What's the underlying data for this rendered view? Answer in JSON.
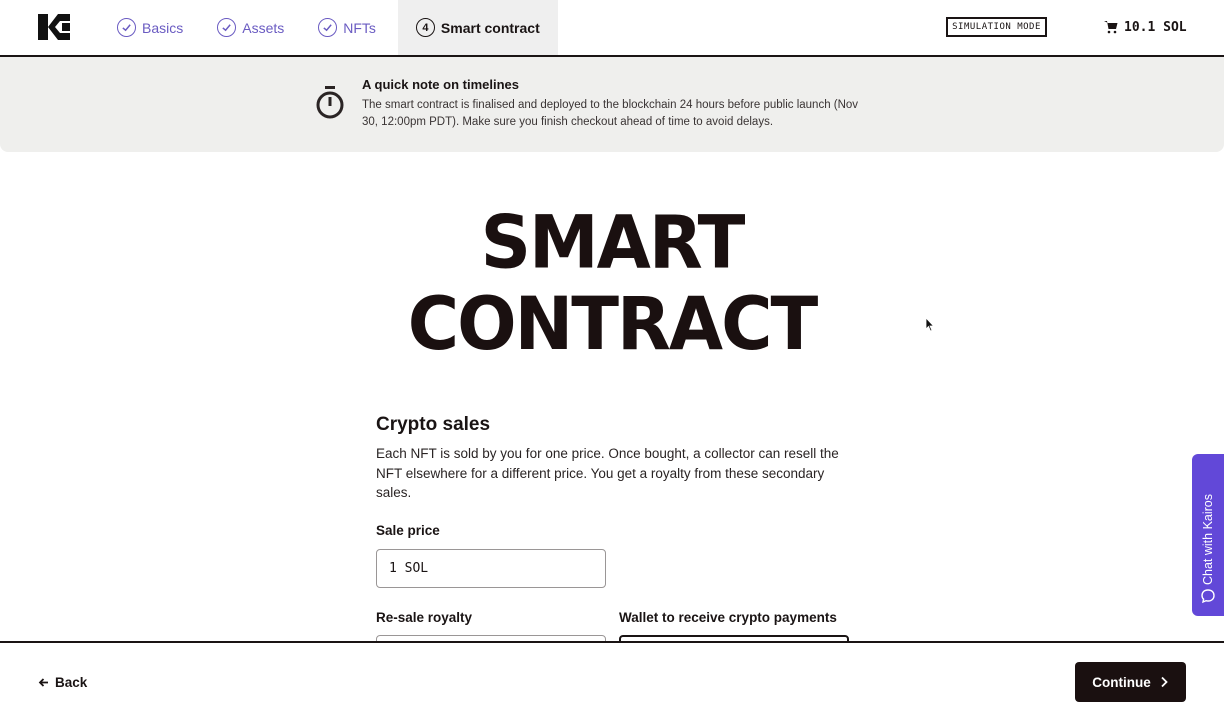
{
  "nav": {
    "steps": [
      {
        "label": "Basics",
        "state": "done"
      },
      {
        "label": "Assets",
        "state": "done"
      },
      {
        "label": "NFTs",
        "state": "done"
      },
      {
        "label": "Smart contract",
        "number": "4",
        "state": "active"
      }
    ],
    "simulation_badge": "SIMULATION MODE",
    "cart_total": "10.1 SOL"
  },
  "notice": {
    "title": "A quick note on timelines",
    "body": "The smart contract is finalised and deployed to the blockchain 24 hours before public launch (Nov 30, 12:00pm PDT). Make sure you finish checkout ahead of time to avoid delays."
  },
  "hero": {
    "line1": "SMART",
    "line2": "CONTRACT"
  },
  "crypto_sales": {
    "title": "Crypto sales",
    "description": "Each NFT is sold by you for one price. Once bought, a collector can resell the NFT elsewhere for a different price. You get a royalty from these secondary sales.",
    "sale_price_label": "Sale price",
    "sale_price_value": "1 SOL",
    "royalty_label": "Re-sale royalty",
    "wallet_label": "Wallet to receive crypto payments"
  },
  "footer": {
    "back_label": "Back",
    "continue_label": "Continue"
  },
  "chat": {
    "label": "Chat with Kairos"
  },
  "colors": {
    "accent": "#6a5bc2",
    "chat_bg": "#6248d8",
    "dark": "#1a1010",
    "banner_bg": "#efefed"
  }
}
